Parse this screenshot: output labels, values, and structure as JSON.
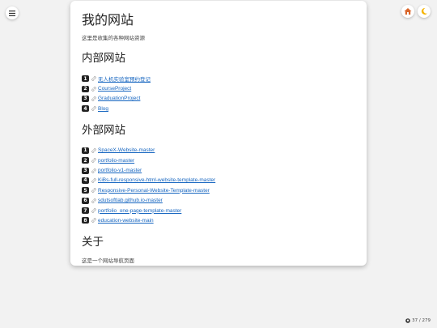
{
  "page": {
    "title": "我的网站",
    "subtitle": "这里是收集的各种网站资源"
  },
  "internal": {
    "heading": "内部网站",
    "items": [
      {
        "num": "1",
        "label": "无人机实验室预约登记"
      },
      {
        "num": "2",
        "label": "CourseProject"
      },
      {
        "num": "3",
        "label": "GraduationProject"
      },
      {
        "num": "4",
        "label": "Blog"
      }
    ]
  },
  "external": {
    "heading": "外部网站",
    "items": [
      {
        "num": "1",
        "label": "SpaceX-Website-master"
      },
      {
        "num": "2",
        "label": "portfolio-master"
      },
      {
        "num": "3",
        "label": "portfolio-v1-master"
      },
      {
        "num": "4",
        "label": "KiBs-full-responsive-html-website-template-master"
      },
      {
        "num": "5",
        "label": "Responsive-Personal-Website-Template-master"
      },
      {
        "num": "6",
        "label": "sdutsoftlab.github.io-master"
      },
      {
        "num": "7",
        "label": "portfolio_one-page-template-master"
      },
      {
        "num": "8",
        "label": "education-website-main"
      }
    ]
  },
  "about": {
    "heading": "关于",
    "text": "这是一个网站导航页面"
  },
  "footer": {
    "counter": "37 / 279"
  },
  "icons": {
    "menu": "hamburger-icon",
    "home": "home-icon",
    "theme": "moon-icon",
    "link": "link-icon",
    "github": "github-icon"
  },
  "colors": {
    "link": "#1565c0",
    "moon": "#f5b400",
    "home": "#d9662b"
  }
}
